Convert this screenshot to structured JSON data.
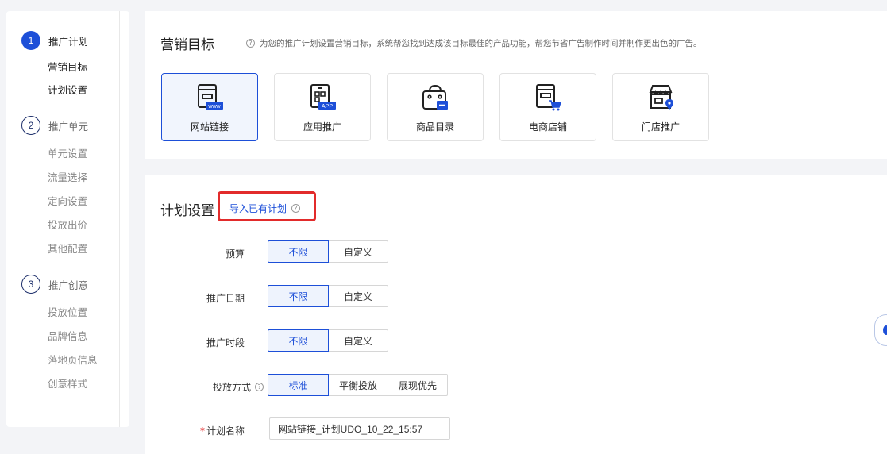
{
  "steps": [
    {
      "num": "1",
      "title": "推广计划",
      "subs": [
        "营销目标",
        "计划设置"
      ]
    },
    {
      "num": "2",
      "title": "推广单元",
      "subs": [
        "单元设置",
        "流量选择",
        "定向设置",
        "投放出价",
        "其他配置"
      ]
    },
    {
      "num": "3",
      "title": "推广创意",
      "subs": [
        "投放位置",
        "品牌信息",
        "落地页信息",
        "创意样式"
      ]
    }
  ],
  "marketing": {
    "title": "营销目标",
    "desc": "为您的推广计划设置营销目标，系统帮您找到达成该目标最佳的产品功能，帮您节省广告制作时间并制作更出色的广告。",
    "goals": [
      {
        "label": "网站链接",
        "icon": "website-link-icon",
        "badge": "www"
      },
      {
        "label": "应用推广",
        "icon": "app-promotion-icon",
        "badge": "APP"
      },
      {
        "label": "商品目录",
        "icon": "product-catalog-icon",
        "badge": ""
      },
      {
        "label": "电商店铺",
        "icon": "ecommerce-store-icon",
        "badge": ""
      },
      {
        "label": "门店推广",
        "icon": "store-promotion-icon",
        "badge": ""
      }
    ]
  },
  "plan": {
    "title": "计划设置",
    "import_label": "导入已有计划",
    "budget": {
      "label": "预算",
      "options": [
        "不限",
        "自定义"
      ]
    },
    "date": {
      "label": "推广日期",
      "options": [
        "不限",
        "自定义"
      ]
    },
    "period": {
      "label": "推广时段",
      "options": [
        "不限",
        "自定义"
      ]
    },
    "delivery": {
      "label": "投放方式",
      "options": [
        "标准",
        "平衡投放",
        "展现优先"
      ]
    },
    "name": {
      "label": "计划名称",
      "value": "网站链接_计划UDO_10_22_15:57"
    }
  },
  "colors": {
    "accent": "#1d4fd8",
    "highlight": "#e22b2b"
  }
}
